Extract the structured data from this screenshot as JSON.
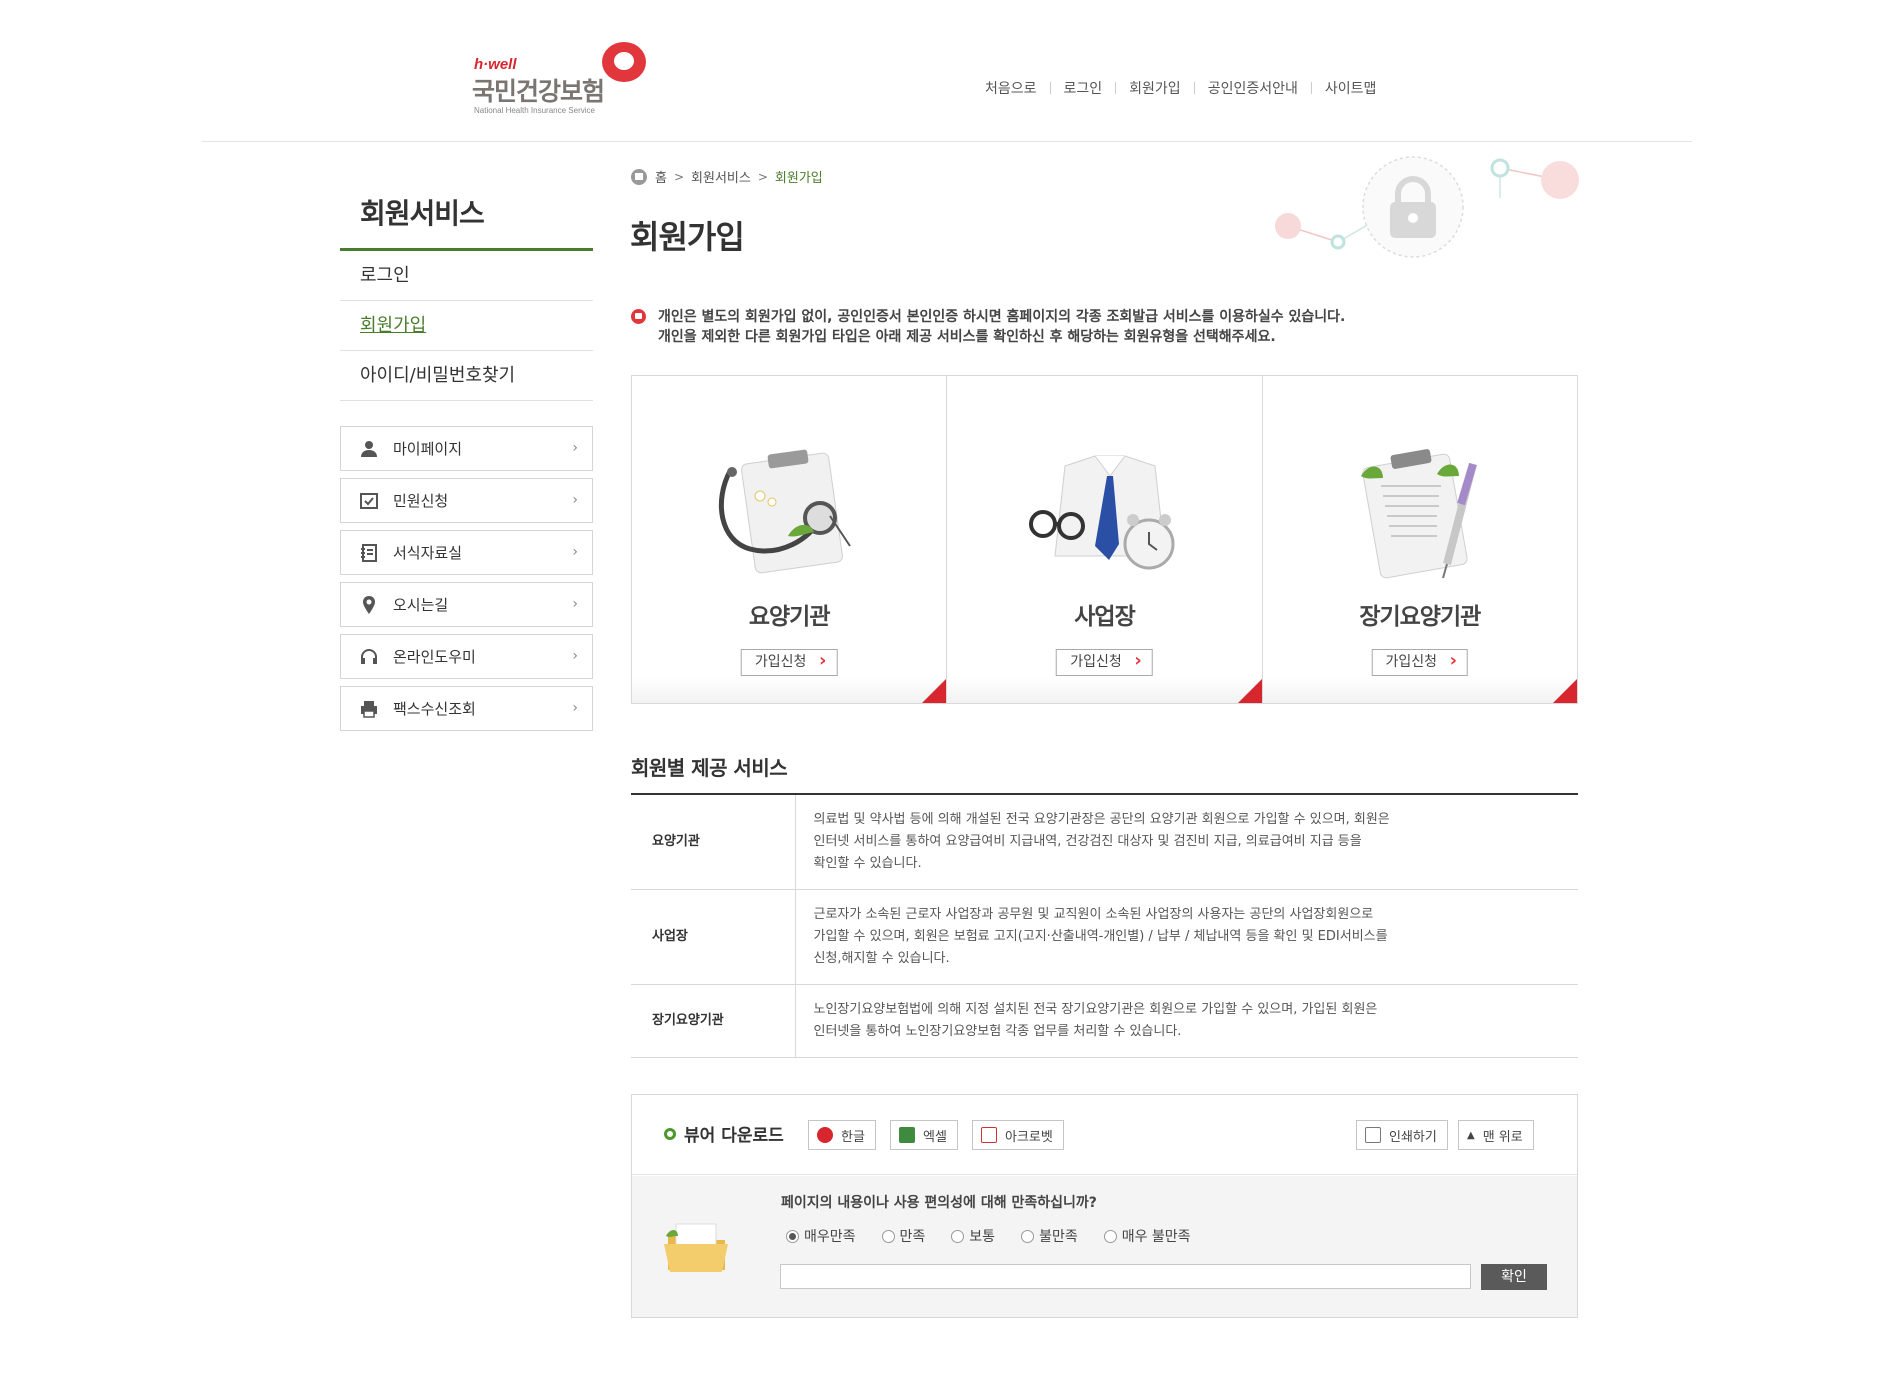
{
  "header": {
    "logo": {
      "brand_small": "h·well",
      "brand_name": "국민건강보험",
      "brand_eng": "National Health Insurance Service"
    },
    "topnav": [
      "처음으로",
      "로그인",
      "회원가입",
      "공인인증서안내",
      "사이트맵"
    ]
  },
  "sidebar": {
    "title": "회원서비스",
    "items": [
      {
        "label": "로그인",
        "active": false
      },
      {
        "label": "회원가입",
        "active": true
      },
      {
        "label": "아이디/비밀번호찾기",
        "active": false
      }
    ],
    "quick": [
      {
        "label": "마이페이지",
        "icon": "person-icon"
      },
      {
        "label": "민원신청",
        "icon": "checklist-icon"
      },
      {
        "label": "서식자료실",
        "icon": "binder-icon"
      },
      {
        "label": "오시는길",
        "icon": "map-pin-icon"
      },
      {
        "label": "온라인도우미",
        "icon": "headset-icon"
      },
      {
        "label": "팩스수신조회",
        "icon": "printer-icon"
      }
    ]
  },
  "breadcrumb": {
    "home": "홈",
    "section": "회원서비스",
    "current": "회원가입"
  },
  "page": {
    "title": "회원가입",
    "notice_line1": "개인은 별도의 회원가입 없이, 공인인증서 본인인증 하시면 홈페이지의 각종 조회발급 서비스를 이용하실수 있습니다.",
    "notice_line2": "개인을 제외한 다른 회원가입 타입은 아래 제공 서비스를 확인하신 후 해당하는 회원유형을 선택해주세요."
  },
  "cards": [
    {
      "label": "요양기관",
      "button": "가입신청"
    },
    {
      "label": "사업장",
      "button": "가입신청"
    },
    {
      "label": "장기요양기관",
      "button": "가입신청"
    }
  ],
  "services": {
    "title": "회원별 제공 서비스",
    "rows": [
      {
        "type": "요양기관",
        "desc_1": "의료법 및 약사법 등에 의해 개설된 전국 요양기관장은 공단의 요양기관 회원으로 가입할 수 있으며, 회원은",
        "desc_2": "인터넷 서비스를 통하여 요양급여비 지급내역, 건강검진 대상자 및 검진비 지급, 의료급여비 지급 등을",
        "desc_3": "확인할 수 있습니다."
      },
      {
        "type": "사업장",
        "desc_1": "근로자가 소속된 근로자 사업장과 공무원 및 교직원이 소속된 사업장의 사용자는 공단의 사업장회원으로",
        "desc_2": "가입할 수 있으며, 회원은 보험료 고지(고지·산출내역-개인별) / 납부 / 체납내역 등을 확인 및 EDI서비스를",
        "desc_3": "신청,해지할 수 있습니다."
      },
      {
        "type": "장기요양기관",
        "desc_1": "노인장기요양보험법에 의해 지정 설치된 전국 장기요양기관은 회원으로 가입할 수 있으며, 가입된 회원은",
        "desc_2": "인터넷을 통하여 노인장기요양보험 각종 업무를 처리할 수 있습니다.",
        "desc_3": ""
      }
    ]
  },
  "viewer": {
    "title": "뷰어 다운로드",
    "buttons": [
      "한글",
      "엑셀",
      "아크로벳"
    ],
    "print": "인쇄하기",
    "top": "맨 위로"
  },
  "survey": {
    "question": "페이지의 내용이나 사용 편의성에 대해 만족하십니까?",
    "options": [
      "매우만족",
      "만족",
      "보통",
      "불만족",
      "매우 불만족"
    ],
    "selected": "매우만족",
    "submit": "확인"
  },
  "colors": {
    "accent_green": "#4a7d2b",
    "brand_red": "#e2363d"
  }
}
